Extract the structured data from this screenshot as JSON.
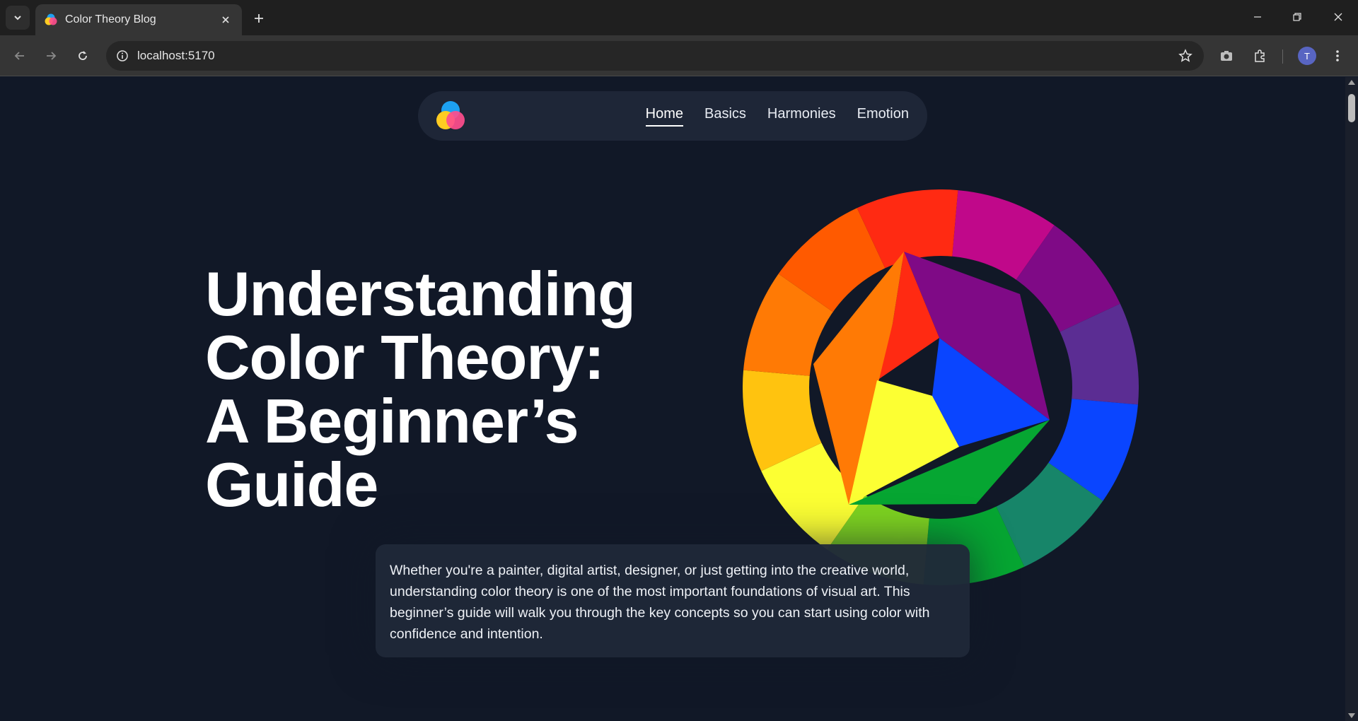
{
  "browser": {
    "tab_title": "Color Theory Blog",
    "url": "localhost:5170",
    "profile_initial": "T",
    "icons": {
      "tab_search": "chevron-down-icon",
      "tab_close": "close-icon",
      "new_tab": "plus-icon",
      "back": "arrow-left-icon",
      "forward": "arrow-right-icon",
      "reload": "reload-icon",
      "site_info": "info-icon",
      "bookmark": "star-icon",
      "screenshot": "camera-icon",
      "extensions": "puzzle-icon",
      "menu": "kebab-menu-icon",
      "minimize": "minimize-icon",
      "restore": "restore-icon",
      "close_window": "close-icon"
    }
  },
  "site": {
    "nav": {
      "items": [
        {
          "label": "Home",
          "active": true
        },
        {
          "label": "Basics",
          "active": false
        },
        {
          "label": "Harmonies",
          "active": false
        },
        {
          "label": "Emotion",
          "active": false
        }
      ]
    },
    "hero": {
      "title_lines": [
        "Understanding",
        "Color Theory:",
        "A Beginner’s",
        "Guide"
      ]
    },
    "intro": {
      "text": "Whether you're a painter, digital artist, designer, or just getting into the creative world, understanding color theory is one of the most important foundations of visual art. This beginner’s guide will walk you through the key concepts so you can start using color with confidence and intention."
    }
  },
  "colors": {
    "page_bg": "#111827",
    "nav_bg": "#1e2637",
    "card_bg": "#1f2838",
    "wheel_ring": [
      "#c0088a",
      "#7f0a86",
      "#5b2d93",
      "#0a45ff",
      "#178569",
      "#06a632",
      "#7ed420",
      "#fcff33",
      "#ffc30f",
      "#ff7a05",
      "#ff5a00",
      "#ff2a12"
    ],
    "wheel_center": {
      "red": "#ff2a12",
      "purple": "#7f0a86",
      "blue": "#0a45ff",
      "green": "#06a632",
      "yellow": "#fcff33",
      "orange": "#ff7a05"
    }
  }
}
